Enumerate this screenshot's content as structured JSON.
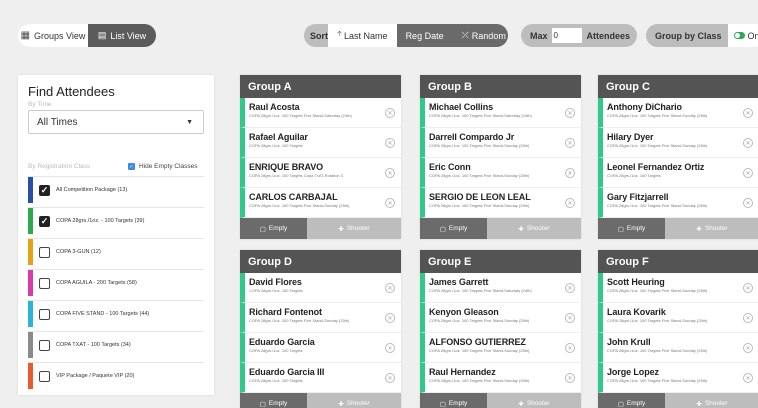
{
  "view_toggle": {
    "groups_label": "Groups View",
    "list_label": "List View"
  },
  "sort": {
    "label": "Sort",
    "last_name": "Last Name",
    "reg_date": "Reg Date",
    "random": "Random"
  },
  "max": {
    "label": "Max",
    "value": "0",
    "unit": "Attendees"
  },
  "group_by": {
    "label": "Group by Class",
    "toggle": "On"
  },
  "panel": {
    "title": "Find Attendees",
    "by_time_label": "By Time",
    "time_value": "All Times",
    "by_class_label": "By Registration Class",
    "hide_empty_label": "Hide Empty Classes",
    "classes": [
      {
        "label": "All Competition Package (13)",
        "checked": true,
        "color": "#2a4fa8"
      },
      {
        "label": "COPA 28grs./1oz. - 100 Targets (39)",
        "checked": true,
        "color": "#2fa84f"
      },
      {
        "label": "COPA 3-GUN (12)",
        "checked": false,
        "color": "#e6a11b"
      },
      {
        "label": "COPA AGUILA - 200 Targets (58)",
        "checked": false,
        "color": "#d83aa8"
      },
      {
        "label": "COPA FIVE STAND - 100 Targets (44)",
        "checked": false,
        "color": "#29b6d6"
      },
      {
        "label": "COPA TXAT - 100 Targets (34)",
        "checked": false,
        "color": "#8a8a8a"
      },
      {
        "label": "VIP Package / Paquete VIP (20)",
        "checked": false,
        "color": "#ea5a2a"
      }
    ]
  },
  "footer": {
    "empty": "Empty",
    "shooter": "Shooter"
  },
  "groups": [
    {
      "title": "Group A",
      "members": [
        {
          "name": "Raul Acosta",
          "detail": "COPA 28grs./1oz. 100 Targets Five Stand-Saturday (24th)"
        },
        {
          "name": "Rafael Aguilar",
          "detail": "COPA 28grs./1oz. 100 Targets"
        },
        {
          "name": "ENRIQUE BRAVO",
          "detail": "COPA 28grs./1oz. 100 Targets Copa TxAT-Rotation 3"
        },
        {
          "name": "CARLOS CARBAJAL",
          "detail": "COPA 28grs./1oz. 100 Targets Five Stand-Sunday (25th)"
        }
      ]
    },
    {
      "title": "Group B",
      "members": [
        {
          "name": "Michael Collins",
          "detail": "COPA 28grs./1oz. 100 Targets Five Stand-Saturday (24th)"
        },
        {
          "name": "Darrell Compardo Jr",
          "detail": "COPA 28grs./1oz. 100 Targets Five Stand-Sunday (25th)"
        },
        {
          "name": "Eric Conn",
          "detail": "COPA 28grs./1oz. 100 Targets Five Stand-Sunday (25th)"
        },
        {
          "name": "SERGIO DE LEON LEAL",
          "detail": "COPA 28grs./1oz. 100 Targets Five Stand-Sunday (25th)"
        }
      ]
    },
    {
      "title": "Group C",
      "members": [
        {
          "name": "Anthony DiChario",
          "detail": "COPA 28grs./1oz. 100 Targets Five Stand-Sunday (25th)"
        },
        {
          "name": "Hilary Dyer",
          "detail": "COPA 28grs./1oz. 100 Targets Five Stand-Sunday (25th)"
        },
        {
          "name": "Leonel Fernandez Ortiz",
          "detail": "COPA 28grs./1oz. 100 Targets"
        },
        {
          "name": "Gary Fitzjarrell",
          "detail": "COPA 28grs./1oz. 100 Targets Five Stand-Sunday (25th)"
        }
      ]
    },
    {
      "title": "Group D",
      "members": [
        {
          "name": "David Flores",
          "detail": "COPA 28grs./1oz. 100 Targets"
        },
        {
          "name": "Richard Fontenot",
          "detail": "COPA 28grs./1oz. 100 Targets Five Stand-Sunday (25th)"
        },
        {
          "name": "Eduardo Garcia",
          "detail": "COPA 28grs./1oz. 100 Targets"
        },
        {
          "name": "Eduardo Garcia III",
          "detail": "COPA 28grs./1oz. 100 Targets"
        }
      ]
    },
    {
      "title": "Group E",
      "members": [
        {
          "name": "James Garrett",
          "detail": "COPA 28grs./1oz. 100 Targets Five Stand-Saturday (24th)"
        },
        {
          "name": "Kenyon Gleason",
          "detail": "COPA 28grs./1oz. 100 Targets Five Stand-Sunday (25th)"
        },
        {
          "name": "ALFONSO GUTIERREZ",
          "detail": "COPA 28grs./1oz. 100 Targets Five Stand-Sunday (25th)"
        },
        {
          "name": "Raul Hernandez",
          "detail": "COPA 28grs./1oz. 100 Targets Five Stand-Sunday (25th)"
        }
      ]
    },
    {
      "title": "Group F",
      "members": [
        {
          "name": "Scott Heuring",
          "detail": "COPA 28grs./1oz. 100 Targets Five Stand-Sunday (25th)"
        },
        {
          "name": "Laura Kovarik",
          "detail": "COPA 28grs./1oz. 100 Targets Five Stand-Sunday (25th)"
        },
        {
          "name": "John Krull",
          "detail": "COPA 28grs./1oz. 100 Targets Five Stand-Sunday (25th)"
        },
        {
          "name": "Jorge Lopez",
          "detail": "COPA 28grs./1oz. 100 Targets Five Stand-Sunday (25th)"
        }
      ]
    }
  ]
}
